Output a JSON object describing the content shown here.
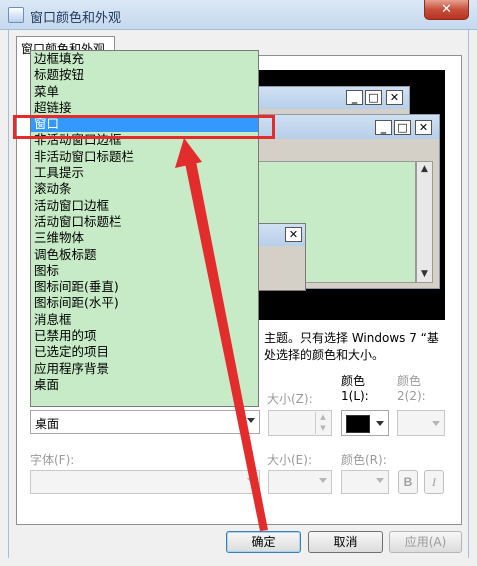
{
  "window": {
    "title": "窗口颜色和外观",
    "close_glyph": "✕"
  },
  "tab": {
    "label": "窗口颜色和外观"
  },
  "preview": {
    "close_glyph": "✕",
    "min_glyph": "_",
    "max_glyph": "□",
    "up_glyph": "▲",
    "down_glyph": "▼"
  },
  "description": {
    "line1": "主题。只有选择 Windows 7 “基",
    "line2": "处选择的颜色和大小。"
  },
  "item": {
    "selected_label": "桌面",
    "size_label": "大小(Z):",
    "color1_label_line1": "颜色",
    "color1_label_line2": "1(L):",
    "color2_label_line1": "颜色",
    "color2_label_line2": "2(2):"
  },
  "font": {
    "font_label": "字体(F):",
    "size_label": "大小(E):",
    "color_label": "颜色(R):",
    "bold_glyph": "B",
    "italic_glyph": "I"
  },
  "dropdown_items": [
    "边框填充",
    "标题按钮",
    "菜单",
    "超链接",
    "窗口",
    "非活动窗口边框",
    "非活动窗口标题栏",
    "工具提示",
    "滚动条",
    "活动窗口边框",
    "活动窗口标题栏",
    "三维物体",
    "调色板标题",
    "图标",
    "图标间距(垂直)",
    "图标间距(水平)",
    "消息框",
    "已禁用的项",
    "已选定的项目",
    "应用程序背景",
    "桌面"
  ],
  "buttons": {
    "ok": "确定",
    "cancel": "取消",
    "apply": "应用(A)"
  },
  "colors": {
    "dropdown_bg": "#c7ebc7",
    "selection": "#3399ff",
    "annotation_red": "#e32c2c",
    "color1_swatch": "#000000"
  }
}
